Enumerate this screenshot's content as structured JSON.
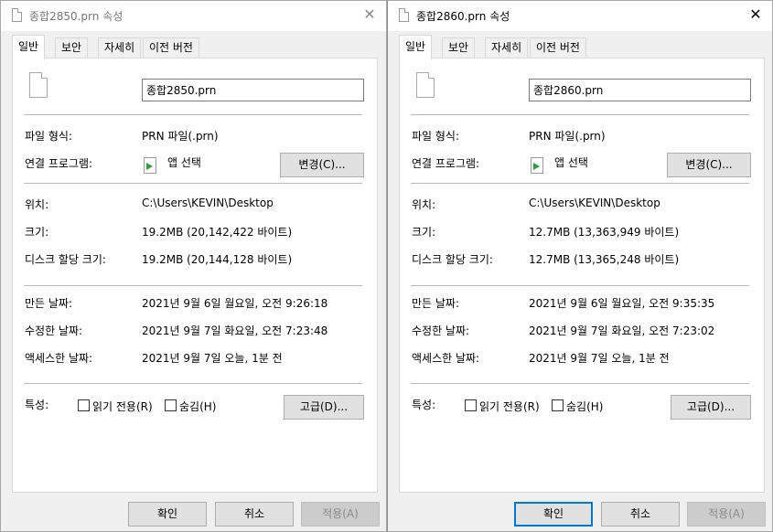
{
  "dialogs": [
    {
      "title": "종합2850.prn 속성",
      "tabs": [
        "일반",
        "보안",
        "자세히",
        "이전 버전"
      ],
      "filename": "종합2850.prn",
      "file_type_label": "파일 형식:",
      "file_type": "PRN 파일(.prn)",
      "open_with_label": "연결 프로그램:",
      "open_with_value": "앱 선택",
      "change_button": "변경(C)...",
      "location_label": "위치:",
      "location": "C:\\Users\\KEVIN\\Desktop",
      "size_label": "크기:",
      "size": "19.2MB (20,142,422 바이트)",
      "size_on_disk_label": "디스크 할당 크기:",
      "size_on_disk": "19.2MB (20,144,128 바이트)",
      "created_label": "만든 날짜:",
      "created": "2021년 9월 6일 월요일, 오전 9:26:18",
      "modified_label": "수정한 날짜:",
      "modified": "2021년 9월 7일 화요일, 오전 7:23:48",
      "accessed_label": "액세스한 날짜:",
      "accessed": "2021년 9월 7일 오늘, 1분 전",
      "attributes_label": "특성:",
      "readonly_label": "읽기 전용(R)",
      "hidden_label": "숨김(H)",
      "advanced_button": "고급(D)...",
      "ok_button": "확인",
      "cancel_button": "취소",
      "apply_button": "적용(A)"
    },
    {
      "title": "종합2860.prn 속성",
      "tabs": [
        "일반",
        "보안",
        "자세히",
        "이전 버전"
      ],
      "filename": "종합2860.prn",
      "file_type_label": "파일 형식:",
      "file_type": "PRN 파일(.prn)",
      "open_with_label": "연결 프로그램:",
      "open_with_value": "앱 선택",
      "change_button": "변경(C)...",
      "location_label": "위치:",
      "location": "C:\\Users\\KEVIN\\Desktop",
      "size_label": "크기:",
      "size": "12.7MB (13,363,949 바이트)",
      "size_on_disk_label": "디스크 할당 크기:",
      "size_on_disk": "12.7MB (13,365,248 바이트)",
      "created_label": "만든 날짜:",
      "created": "2021년 9월 6일 월요일, 오전 9:35:35",
      "modified_label": "수정한 날짜:",
      "modified": "2021년 9월 7일 화요일, 오전 7:23:02",
      "accessed_label": "액세스한 날짜:",
      "accessed": "2021년 9월 7일 오늘, 1분 전",
      "attributes_label": "특성:",
      "readonly_label": "읽기 전용(R)",
      "hidden_label": "숨김(H)",
      "advanced_button": "고급(D)...",
      "ok_button": "확인",
      "cancel_button": "취소",
      "apply_button": "적용(A)"
    }
  ],
  "icons": {
    "title_file": "file-icon",
    "close": "close-icon",
    "file": "file-icon",
    "app": "app-select-icon"
  },
  "close_glyph": "✕",
  "colors": {
    "dialog_bg": "#f0f0f0",
    "panel_bg": "#ffffff",
    "accent": "#0078d7",
    "app_arrow": "#2e9e3e"
  }
}
